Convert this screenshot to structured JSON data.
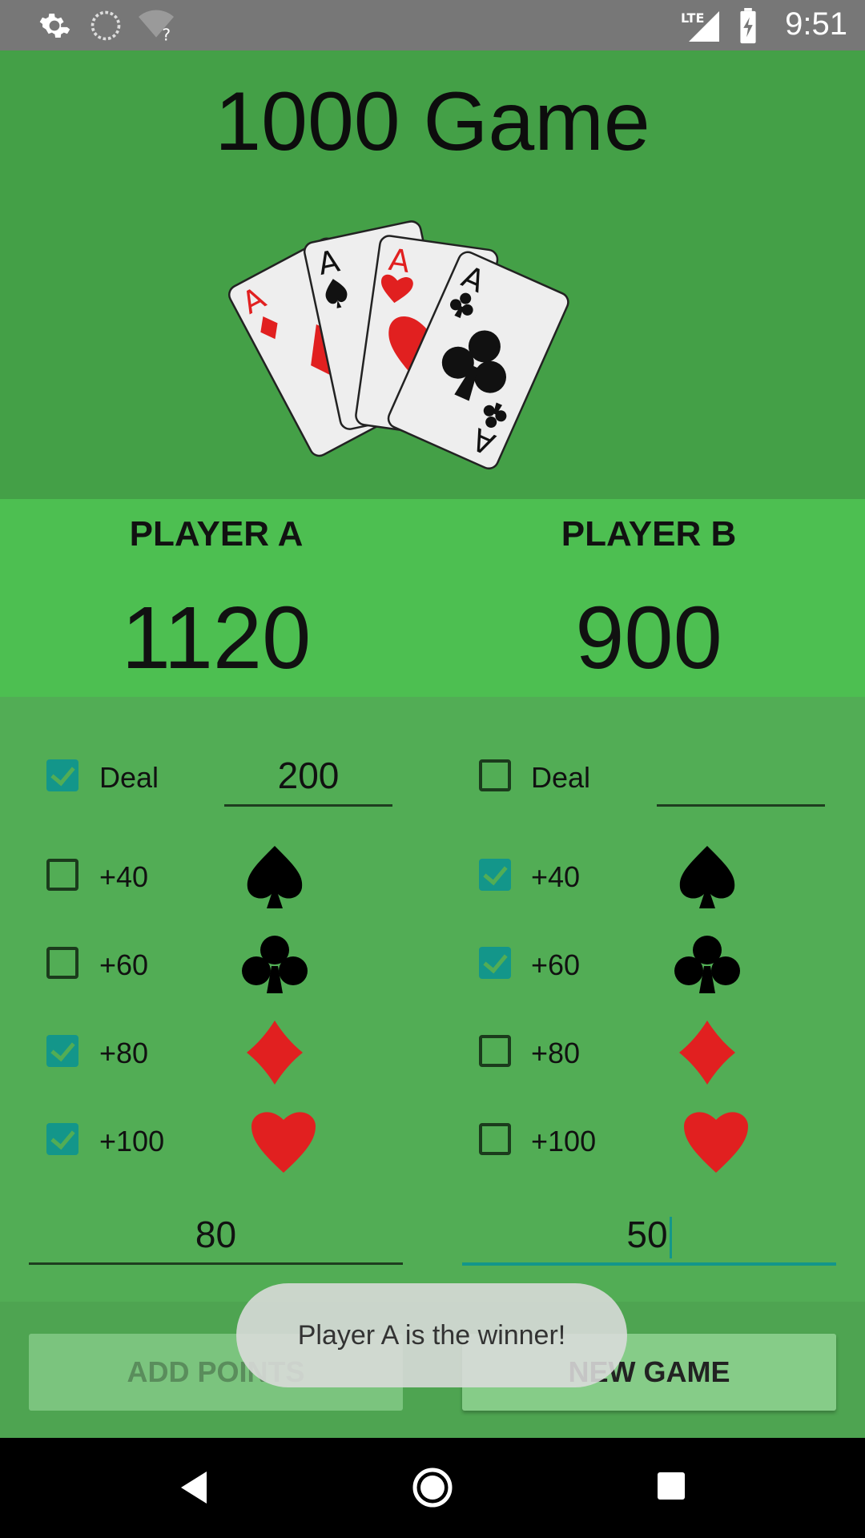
{
  "status_bar": {
    "time": "9:51",
    "left_icons": [
      "settings-icon",
      "sync-icon",
      "wifi-unknown-icon"
    ],
    "right_icons": [
      "lte-signal-icon",
      "battery-charging-icon"
    ],
    "network_label": "LTE"
  },
  "app": {
    "title": "1000 Game"
  },
  "players": [
    {
      "name": "PLAYER A",
      "score": "1120"
    },
    {
      "name": "PLAYER B",
      "score": "900"
    }
  ],
  "player_a": {
    "deal": {
      "label": "Deal",
      "checked": true,
      "value": "200"
    },
    "bonuses": [
      {
        "label": "+40",
        "checked": false,
        "suit": "spade-icon"
      },
      {
        "label": "+60",
        "checked": false,
        "suit": "club-icon"
      },
      {
        "label": "+80",
        "checked": true,
        "suit": "diamond-icon"
      },
      {
        "label": "+100",
        "checked": true,
        "suit": "heart-icon"
      }
    ],
    "points": "80"
  },
  "player_b": {
    "deal": {
      "label": "Deal",
      "checked": false,
      "value": ""
    },
    "bonuses": [
      {
        "label": "+40",
        "checked": true,
        "suit": "spade-icon"
      },
      {
        "label": "+60",
        "checked": true,
        "suit": "club-icon"
      },
      {
        "label": "+80",
        "checked": false,
        "suit": "diamond-icon"
      },
      {
        "label": "+100",
        "checked": false,
        "suit": "heart-icon"
      }
    ],
    "points": "50"
  },
  "buttons": {
    "add_points": "ADD POINTS",
    "new_game": "NEW GAME"
  },
  "toast": "Player A is the winner!",
  "card_art": {
    "cards": [
      "A",
      "A",
      "A",
      "A"
    ]
  },
  "colors": {
    "header_green": "#44a047",
    "score_green": "#4dbf51",
    "control_green": "#52ad55",
    "checkbox_teal": "#13968a",
    "suit_red": "#e12020"
  },
  "nav_bar": {
    "icons": [
      "back-icon",
      "home-icon",
      "recents-icon"
    ]
  }
}
